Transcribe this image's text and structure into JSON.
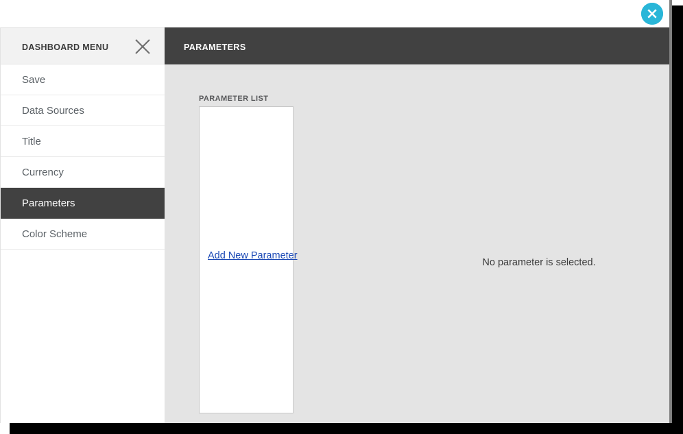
{
  "window": {
    "close_button_icon": "close-circle-icon"
  },
  "sidebar": {
    "title": "DASHBOARD MENU",
    "close_icon": "close-x-icon",
    "items": [
      {
        "label": "Save",
        "active": false
      },
      {
        "label": "Data Sources",
        "active": false
      },
      {
        "label": "Title",
        "active": false
      },
      {
        "label": "Currency",
        "active": false
      },
      {
        "label": "Parameters",
        "active": true
      },
      {
        "label": "Color Scheme",
        "active": false
      }
    ]
  },
  "main": {
    "header_title": "PARAMETERS",
    "parameter_list_label": "PARAMETER LIST",
    "add_new_parameter_label": "Add New Parameter",
    "empty_state_message": "No parameter is selected.",
    "parameters": []
  },
  "colors": {
    "header_dark": "#414141",
    "panel_background": "#e4e4e4",
    "accent_close": "#29b6d8",
    "link": "#1a48b5",
    "sidebar_header": "#f2f2f2"
  }
}
